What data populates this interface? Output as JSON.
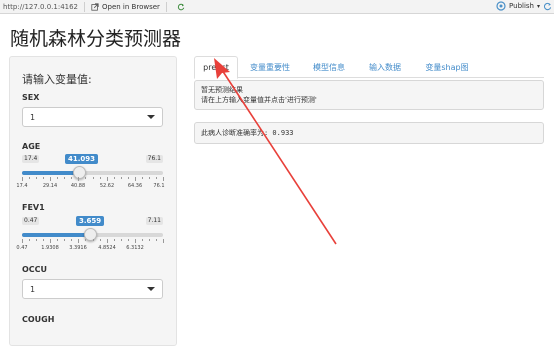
{
  "topbar": {
    "url": "http://127.0.0.1:4162",
    "open_in_browser": "Open in Browser",
    "publish": "Publish"
  },
  "app_title": "随机森林分类预测器",
  "sidebar": {
    "heading": "请输入变量值:",
    "sex": {
      "label": "SEX",
      "value": "1"
    },
    "age": {
      "label": "AGE",
      "min": "17.4",
      "max": "76.1",
      "value": "41.093",
      "fraction": 0.403,
      "ticks": [
        "17.4",
        "29.14",
        "40.88",
        "52.62",
        "64.36",
        "76.1"
      ]
    },
    "fev1": {
      "label": "FEV1",
      "min": "0.47",
      "max": "7.11",
      "value": "3.659",
      "fraction": 0.48,
      "ticks": [
        "0.47",
        "1.9308",
        "3.3916",
        "4.8524",
        "6.3132"
      ]
    },
    "occu": {
      "label": "OCCU",
      "value": "1"
    },
    "cough": {
      "label": "COUGH"
    }
  },
  "tabs": [
    {
      "label": "predct",
      "active": true
    },
    {
      "label": "变量重要性",
      "active": false
    },
    {
      "label": "模型信息",
      "active": false
    },
    {
      "label": "输入数据",
      "active": false
    },
    {
      "label": "变量shap图",
      "active": false
    }
  ],
  "prediction": {
    "line1": "暂无预测结果",
    "line2": "请在上方输入变量值并点击'进行预测'"
  },
  "accuracy_text": "此病人诊断准确率为: 0.933",
  "colors": {
    "accent": "#428bca",
    "arrow": "#e8403a"
  }
}
